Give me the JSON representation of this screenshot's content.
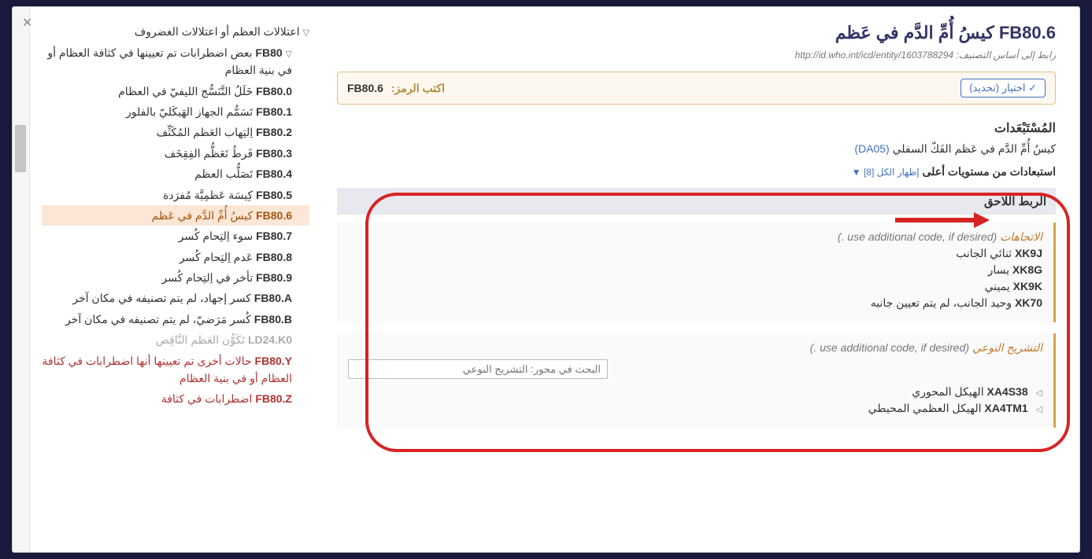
{
  "title": {
    "code": "FB80.6",
    "text": "كيسُ أُمِّ الدَّم في عَظم"
  },
  "foundation": {
    "label": "رابط إلى أساس التصنيف:",
    "url": "http://id.who.int/icd/entity/1603788294"
  },
  "select_btn": "✓ اختيار (تحديد)",
  "code_bar": {
    "label": "اكتب الرمز:",
    "value": "FB80.6"
  },
  "exclusions_h": "المُسْتَبْعَدات",
  "exclusion1": {
    "text": "كيسُ أُمِّ الدَّم في عَظم الفَكّ السفلي",
    "link": "(DA05)"
  },
  "upward_excl": {
    "text": "استبعادات من مستويات أعلى",
    "toggle": "إظهار الكل [8] ▼"
  },
  "post_h": "الربط اللاحق",
  "axis1": {
    "title": "الاتجاهات",
    "hint": "(. use additional code, if desired)",
    "rows": [
      {
        "code": "XK9J",
        "label": "ثنائي الجانب"
      },
      {
        "code": "XK8G",
        "label": "يسار"
      },
      {
        "code": "XK9K",
        "label": "يميني"
      },
      {
        "code": "XK70",
        "label": "وحيد الجانب، لم يتم تعيين جانبه"
      }
    ]
  },
  "axis2": {
    "title": "التشريح النوعي",
    "hint": "(. use additional code, if desired)",
    "placeholder": "البحث في محور: التشريح النوعي",
    "rows": [
      {
        "code": "XA4S38",
        "label": "الهيكل المحوري",
        "expandable": true
      },
      {
        "code": "XA4TM1",
        "label": "الهيكل العظمي المحيطي",
        "expandable": true
      }
    ]
  },
  "tree": [
    {
      "lvl": 1,
      "caret": "▽",
      "text": "اعتلالات العظم أو اعتلالات الغضروف"
    },
    {
      "lvl": 2,
      "caret": "▽",
      "code": "FB80",
      "text": "بعض اضطرابات تم تعيينها في كثافة العظام أو في بنية العظام"
    },
    {
      "lvl": 2,
      "code": "FB80.0",
      "text": "خَلَلُ التَّنَسُّج الليفيّ في العظام"
    },
    {
      "lvl": 2,
      "code": "FB80.1",
      "text": "تَسَمُّم الجهاز الهَيكَليّ بالفلور"
    },
    {
      "lvl": 2,
      "code": "FB80.2",
      "text": "اِلتِهاب العَظم المُكَثِّف"
    },
    {
      "lvl": 2,
      "code": "FB80.3",
      "text": "فَرطُ تَعَظُّم الفِقِخَف"
    },
    {
      "lvl": 2,
      "code": "FB80.4",
      "text": "تَصَلُّب العظم"
    },
    {
      "lvl": 2,
      "code": "FB80.5",
      "text": "كِيسَة عَظمِيَّة مُفرَدة"
    },
    {
      "lvl": 2,
      "code": "FB80.6",
      "text": "كيسُ أُمِّ الدَّم في عَظم",
      "selected": true
    },
    {
      "lvl": 2,
      "code": "FB80.7",
      "text": "سوء اِلتِحام كُسر"
    },
    {
      "lvl": 2,
      "code": "FB80.8",
      "text": "عَدم اِلتِحام كُسر"
    },
    {
      "lvl": 2,
      "code": "FB80.9",
      "text": "تأخر في اِلتِحام كُسر"
    },
    {
      "lvl": 2,
      "code": "FB80.A",
      "text": "كسر إجهاد، لم يتم تصنيفه في مكان آخر"
    },
    {
      "lvl": 2,
      "code": "FB80.B",
      "text": "كُسر مَرَضيّ، لم يتم تصنيفه في مكان آخر"
    },
    {
      "lvl": 2,
      "code": "LD24.K0",
      "text": "تَكَوُّن العَظم النَّاقِص",
      "dim": true
    },
    {
      "lvl": 2,
      "code": "FB80.Y",
      "text": "حالات أخرى تم تعيينها أنها اضطرابات في كثافة العظام أو في بنية العظام",
      "red": true
    },
    {
      "lvl": 2,
      "code": "FB80.Z",
      "text": "اضطرابات في كثافة",
      "red": true
    }
  ]
}
